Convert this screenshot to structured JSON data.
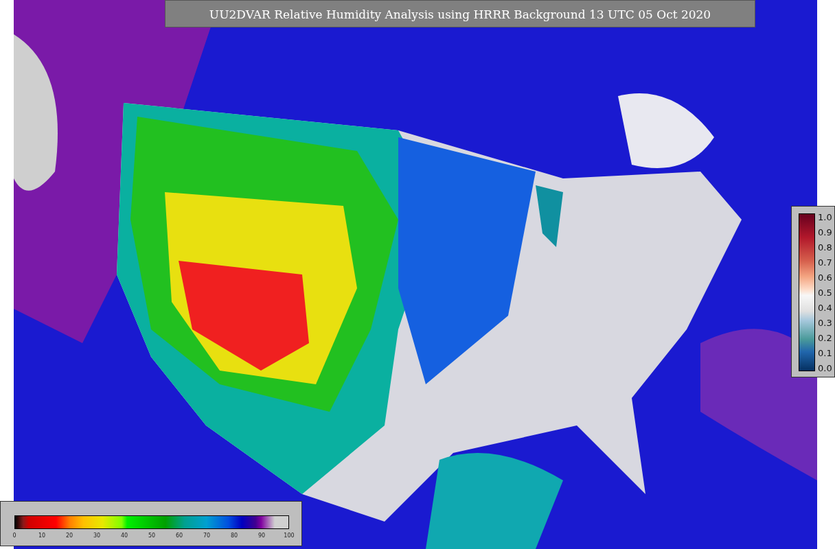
{
  "title": "UU2DVAR Relative Humidity Analysis using HRRR Background 13 UTC 05 Oct 2020",
  "station_legend": {
    "ticks": [
      "1.0",
      "0.9",
      "0.8",
      "0.7",
      "0.6",
      "0.5",
      "0.4",
      "0.3",
      "0.2",
      "0.1",
      "0.0"
    ]
  },
  "humidity_legend": {
    "ticks": [
      "0",
      "10",
      "20",
      "30",
      "40",
      "50",
      "60",
      "70",
      "80",
      "90",
      "100"
    ]
  }
}
